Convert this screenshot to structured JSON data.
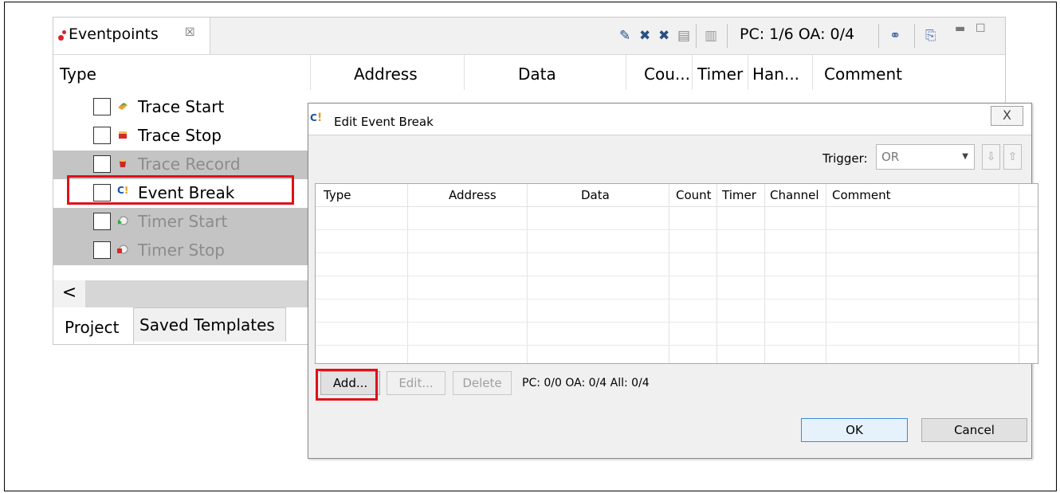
{
  "eventpoints_view": {
    "tab_label": "Eventpoints",
    "tab_close_glyph": "☒",
    "toolbar": {
      "icons": [
        "remove-icon",
        "remove-all-icon",
        "remove-all-pointer-icon",
        "copy-icon",
        "paste-icon",
        "link-icon",
        "export-icon"
      ],
      "status": "PC: 1/6 OA: 0/4"
    },
    "columns": [
      "Type",
      "Address",
      "Data",
      "Cou...",
      "Timer",
      "Han...",
      "Comment"
    ],
    "rows": [
      {
        "label": "Trace Start",
        "enabled": true,
        "icon": "trace-start-icon"
      },
      {
        "label": "Trace Stop",
        "enabled": true,
        "icon": "trace-stop-icon"
      },
      {
        "label": "Trace Record",
        "enabled": false,
        "icon": "trace-record-icon"
      },
      {
        "label": "Event Break",
        "enabled": true,
        "icon": "event-break-icon",
        "icon_text": "C!"
      },
      {
        "label": "Timer Start",
        "enabled": false,
        "icon": "timer-start-icon"
      },
      {
        "label": "Timer Stop",
        "enabled": false,
        "icon": "timer-stop-icon"
      }
    ],
    "scroll_left_glyph": "<",
    "bottom_tabs": [
      "Project",
      "Saved Templates"
    ]
  },
  "dialog": {
    "title": "Edit Event Break",
    "icon_text": "C!",
    "close_glyph": "X",
    "trigger_label": "Trigger:",
    "trigger_value": "OR",
    "table_columns": [
      "Type",
      "Address",
      "Data",
      "Count",
      "Timer",
      "Channel",
      "Comment"
    ],
    "buttons": {
      "add": "Add...",
      "edit": "Edit...",
      "delete": "Delete",
      "ok": "OK",
      "cancel": "Cancel"
    },
    "status": "PC: 0/0 OA: 0/4 All: 0/4"
  },
  "colors": {
    "highlight": "#e0101a",
    "accent": "#3c8ad6"
  }
}
